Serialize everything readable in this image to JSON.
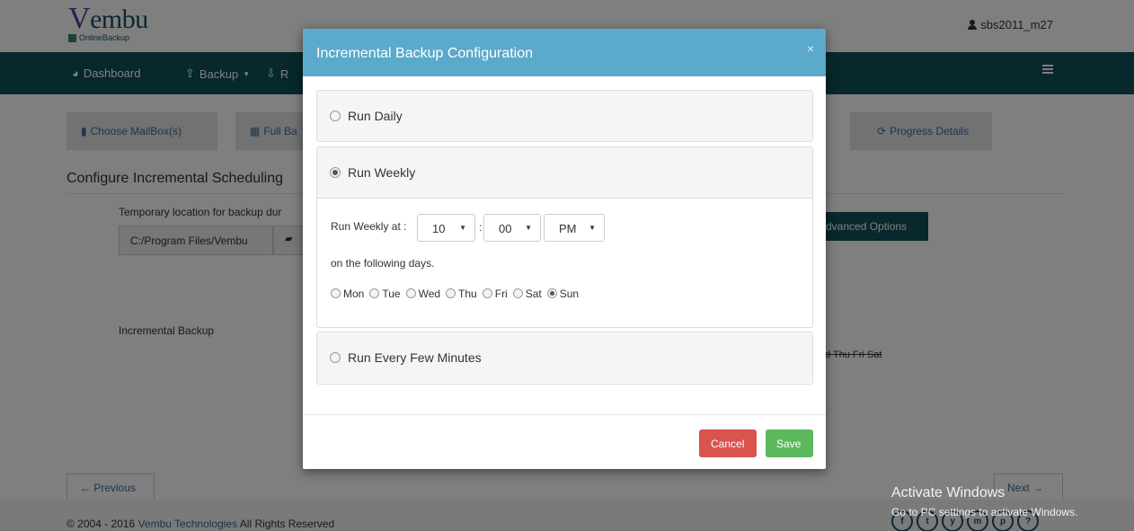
{
  "header": {
    "logo_main": "embu",
    "logo_v": "V",
    "logo_sub": "OnlineBackup",
    "user": "sbs2011_m27"
  },
  "nav": {
    "dashboard": "Dashboard",
    "backup": "Backup",
    "restore_partial": "R"
  },
  "steps": {
    "choose_mailbox": "Choose MailBox(s)",
    "full_backup_partial": "Full Ba",
    "progress_details": "Progress Details"
  },
  "page": {
    "section_title": "Configure Incremental Scheduling",
    "temp_label": "Temporary location for backup dur",
    "temp_value": "C:/Program Files/Vembu",
    "advanced_partial": "dvanced Options",
    "incremental_label": "Incremental Backup",
    "days_strike": "d Thu Fri Sat",
    "prev": "Previous",
    "next": "Next"
  },
  "footer": {
    "copyright_prefix": "© 2004 - 2016",
    "company": "Vembu Technologies",
    "rights": "All Rights Reserved",
    "social": [
      "f",
      "t",
      "y",
      "m",
      "p",
      "?"
    ]
  },
  "watermark": {
    "title": "Activate Windows",
    "sub": "Go to PC settings to activate Windows."
  },
  "modal": {
    "title": "Incremental Backup Configuration",
    "close": "×",
    "options": {
      "daily": "Run Daily",
      "weekly": "Run Weekly",
      "minutes": "Run Every Few Minutes"
    },
    "selected_option": "weekly",
    "run_weekly_at": "Run Weekly at :",
    "hour": "10",
    "minute": "00",
    "ampm": "PM",
    "colon": ":",
    "following_days": "on the following days.",
    "days": [
      "Mon",
      "Tue",
      "Wed",
      "Thu",
      "Fri",
      "Sat",
      "Sun"
    ],
    "selected_day": "Sun",
    "cancel": "Cancel",
    "save": "Save"
  }
}
